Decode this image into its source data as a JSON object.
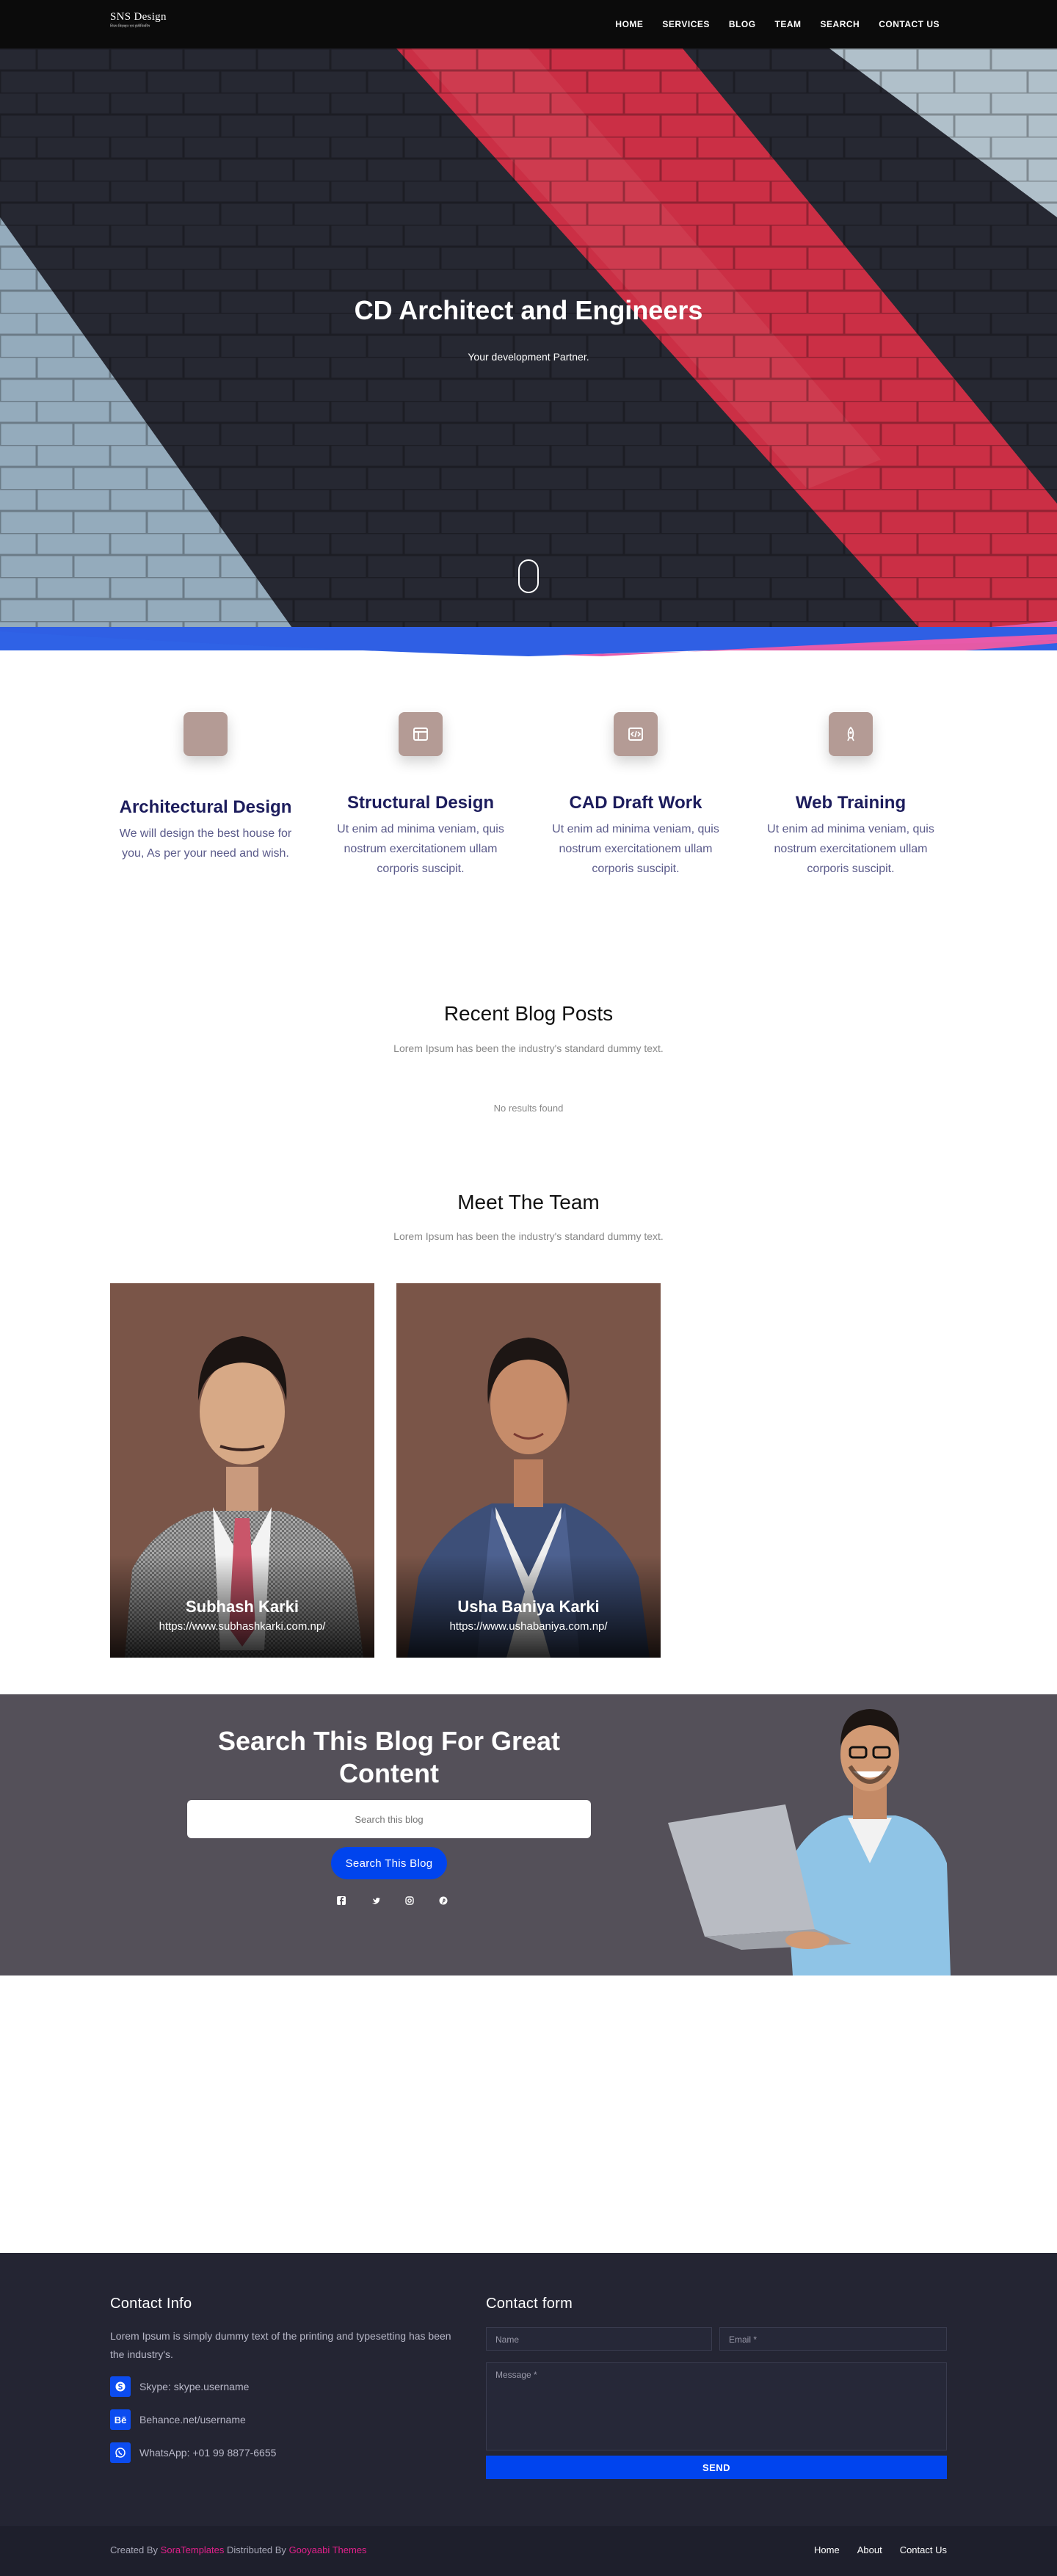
{
  "header": {
    "logo_title": "SNS Design",
    "logo_tagline": "शिल्प डिज़ाइन एवं इंजीनियरिंग",
    "nav": [
      "HOME",
      "SERVICES",
      "BLOG",
      "TEAM",
      "SEARCH",
      "CONTACT US"
    ]
  },
  "hero": {
    "title": "CD Architect and Engineers",
    "subtitle": "Your development Partner."
  },
  "services": [
    {
      "title": "Architectural Design",
      "desc": "We will design the best house for you, As per your need and wish."
    },
    {
      "title": "Structural Design",
      "desc": "Ut enim ad minima veniam, quis nostrum exercitationem ullam corporis suscipit."
    },
    {
      "title": "CAD Draft Work",
      "desc": "Ut enim ad minima veniam, quis nostrum exercitationem ullam corporis suscipit."
    },
    {
      "title": "Web Training",
      "desc": "Ut enim ad minima veniam, quis nostrum exercitationem ullam corporis suscipit."
    }
  ],
  "blog": {
    "title": "Recent Blog Posts",
    "subtitle": "Lorem Ipsum has been the industry's standard dummy text.",
    "empty": "No results found"
  },
  "team": {
    "title": "Meet The Team",
    "subtitle": "Lorem Ipsum has been the industry's standard dummy text.",
    "members": [
      {
        "name": "Subhash Karki",
        "url": "https://www.subhashkarki.com.np/"
      },
      {
        "name": "Usha Baniya Karki",
        "url": "https://www.ushabaniya.com.np/"
      }
    ]
  },
  "search_band": {
    "title": "Search This Blog For Great Content",
    "placeholder": "Search this blog",
    "button": "Search This Blog"
  },
  "contact_info": {
    "title": "Contact Info",
    "text": "Lorem Ipsum is simply dummy text of the printing and typesetting has been the industry's.",
    "skype": "Skype: skype.username",
    "behance": "Behance.net/username",
    "whatsapp": "WhatsApp: +01 99 8877-6655"
  },
  "contact_form": {
    "title": "Contact form",
    "name_placeholder": "Name",
    "email_placeholder": "Email *",
    "message_placeholder": "Message *",
    "send": "SEND"
  },
  "copyright": {
    "created_by": "Created By",
    "sora": "SoraTemplates",
    "distributed": "Distributed By",
    "gooyaabi": "Gooyaabi Themes",
    "links": [
      "Home",
      "About",
      "Contact Us"
    ]
  },
  "colors": {
    "accent": "#0044ee",
    "brand_pink": "#e2208b",
    "navy_heading": "#1c1c5c"
  }
}
